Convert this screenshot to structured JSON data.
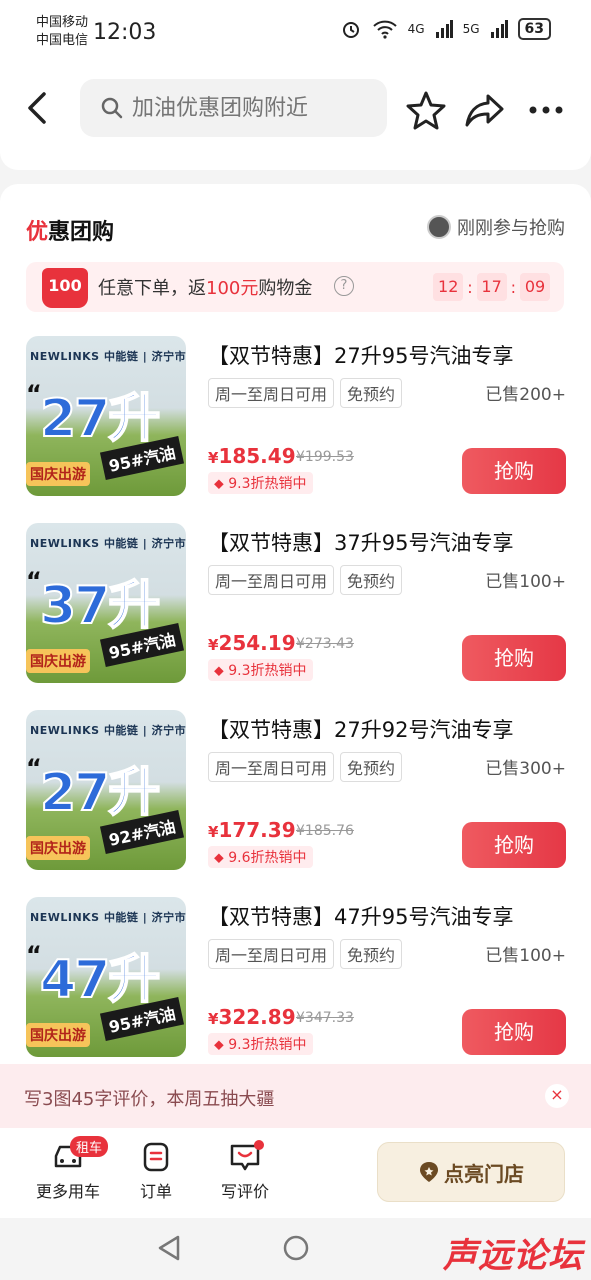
{
  "status": {
    "carrier1": "中国移动",
    "carrier2": "中国电信",
    "time": "12:03",
    "net1": "4G",
    "net2": "5G",
    "battery": "63"
  },
  "nav": {
    "search_placeholder": "加油优惠团购附近"
  },
  "section": {
    "title_mark": "优",
    "title_rest": "惠团购",
    "participants": "刚刚参与抢购"
  },
  "promo": {
    "badge": "100",
    "text_before": "任意下单，返",
    "amount": "100元",
    "text_after": "购物金",
    "help": "?",
    "timer": [
      "12",
      "17",
      "09"
    ]
  },
  "products": [
    {
      "title": "【双节特惠】27升95号汽油专享",
      "tags": [
        "周一至周日可用",
        "免预约"
      ],
      "sold": "已售200+",
      "yen": "¥",
      "price": "185.49",
      "original": "¥199.53",
      "discount": "9.3折热销中",
      "buy_label": "抢购",
      "thumb_brand": "NEWLINKS 中能链 | 济宁市适用",
      "thumb_big": "27升",
      "thumb_fuel": "95#汽油",
      "thumb_tag": "国庆出游"
    },
    {
      "title": "【双节特惠】37升95号汽油专享",
      "tags": [
        "周一至周日可用",
        "免预约"
      ],
      "sold": "已售100+",
      "yen": "¥",
      "price": "254.19",
      "original": "¥273.43",
      "discount": "9.3折热销中",
      "buy_label": "抢购",
      "thumb_brand": "NEWLINKS 中能链 | 济宁市适用",
      "thumb_big": "37升",
      "thumb_fuel": "95#汽油",
      "thumb_tag": "国庆出游"
    },
    {
      "title": "【双节特惠】27升92号汽油专享",
      "tags": [
        "周一至周日可用",
        "免预约"
      ],
      "sold": "已售300+",
      "yen": "¥",
      "price": "177.39",
      "original": "¥185.76",
      "discount": "9.6折热销中",
      "buy_label": "抢购",
      "thumb_brand": "NEWLINKS 中能链 | 济宁市适用",
      "thumb_big": "27升",
      "thumb_fuel": "92#汽油",
      "thumb_tag": "国庆出游"
    },
    {
      "title": "【双节特惠】47升95号汽油专享",
      "tags": [
        "周一至周日可用",
        "免预约"
      ],
      "sold": "已售100+",
      "yen": "¥",
      "price": "322.89",
      "original": "¥347.33",
      "discount": "9.3折热销中",
      "buy_label": "抢购",
      "thumb_brand": "NEWLINKS 中能链 | 济宁市适用",
      "thumb_big": "47升",
      "thumb_fuel": "95#汽油",
      "thumb_tag": "国庆出游"
    }
  ],
  "review": {
    "text": "写3图45字评价，本周五抽大疆",
    "close": "×"
  },
  "bottom": {
    "rent_badge": "租车",
    "tab_more": "更多用车",
    "tab_orders": "订单",
    "tab_review": "写评价",
    "store_button": "点亮门店"
  },
  "watermark": "声远论坛",
  "colors": {
    "accent": "#e8323c",
    "store_bg": "#f7efe0"
  }
}
